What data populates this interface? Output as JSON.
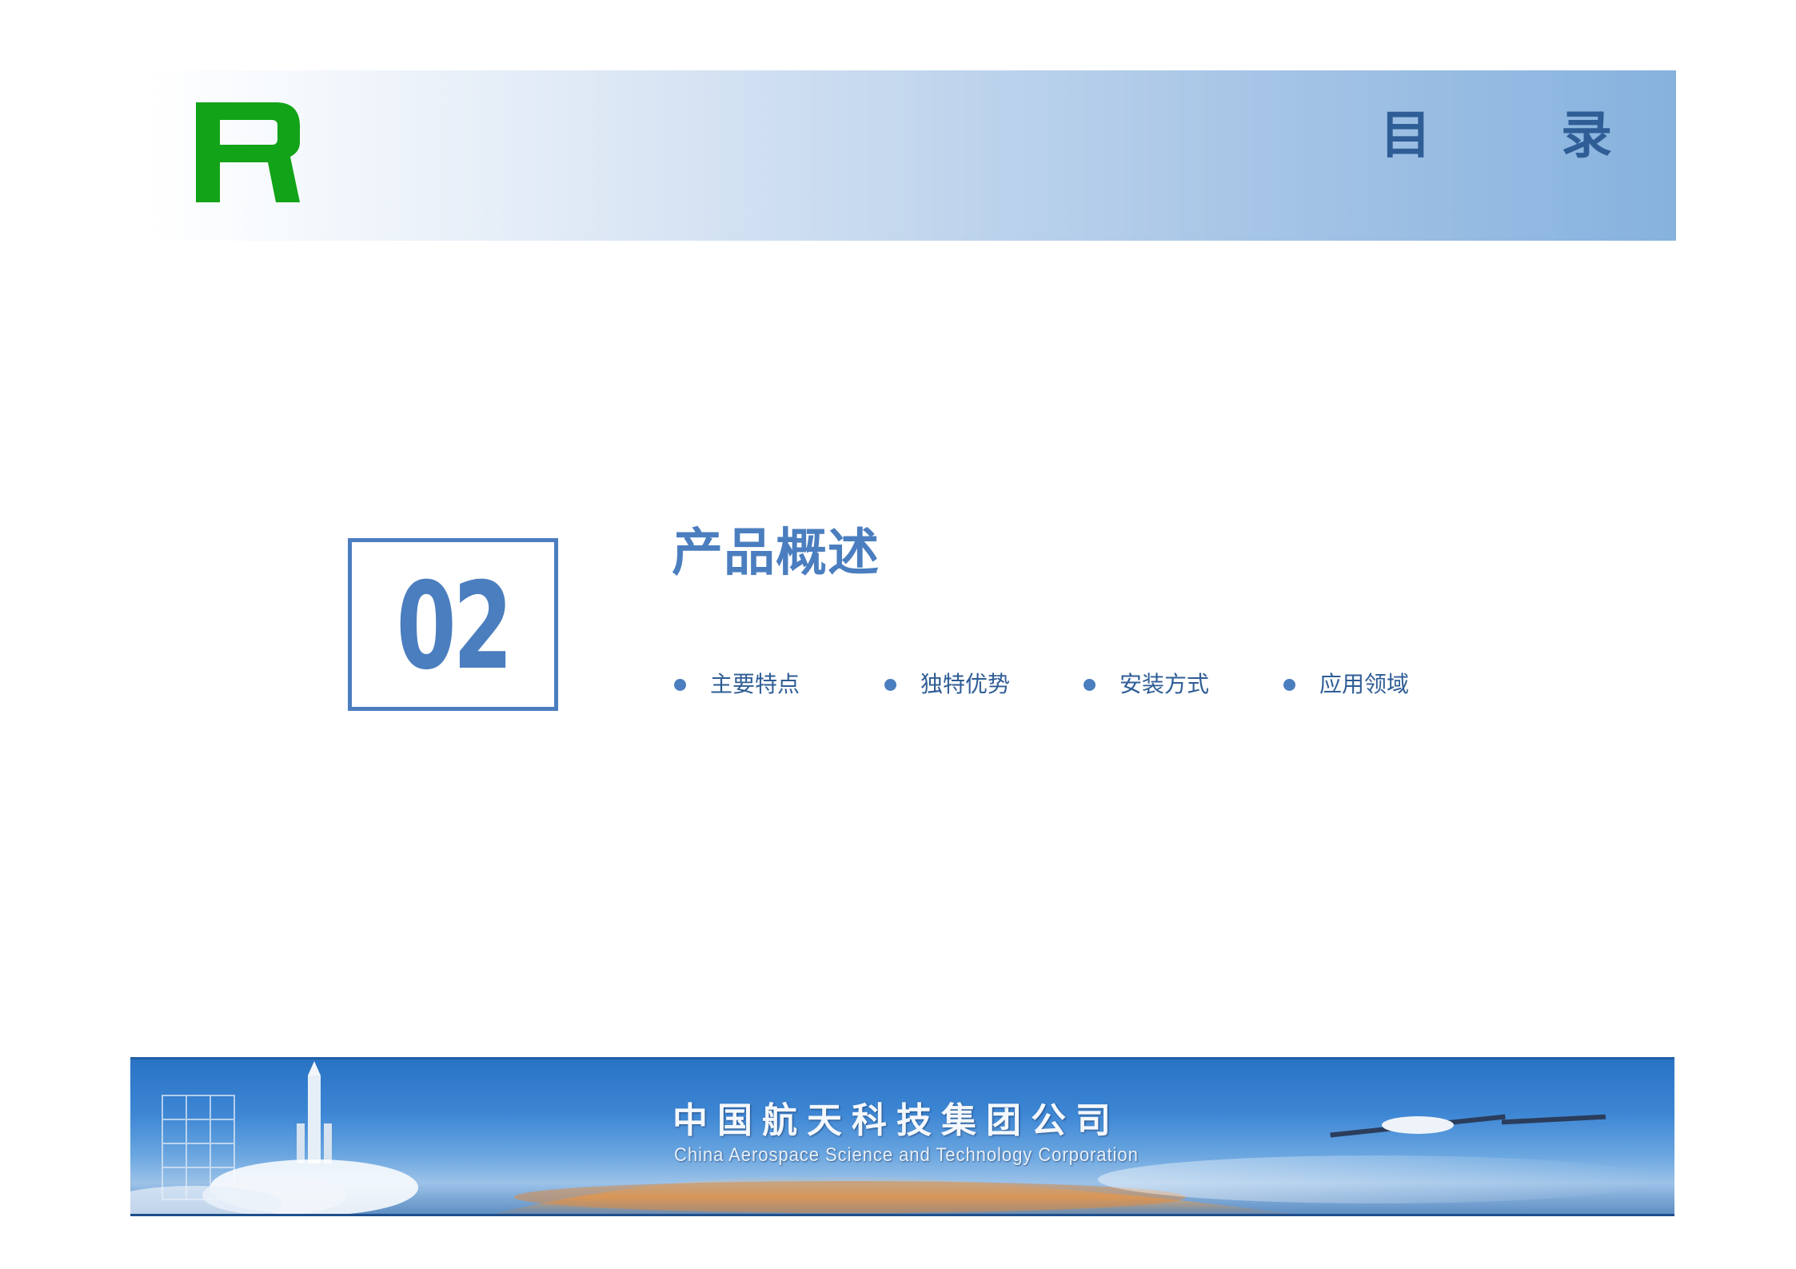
{
  "header": {
    "logo_letter": "R",
    "title": "目 录"
  },
  "section": {
    "number": "02",
    "title": "产品概述",
    "bullets": [
      {
        "label": "主要特点"
      },
      {
        "label": "独特优势"
      },
      {
        "label": "安装方式"
      },
      {
        "label": "应用领域"
      }
    ]
  },
  "footer": {
    "company_cn": "中国航天科技集团公司",
    "company_en": "China Aerospace Science and Technology Corporation"
  },
  "colors": {
    "accent_blue": "#4b7ebf",
    "title_blue": "#2f5d95",
    "logo_green": "#12a318"
  }
}
